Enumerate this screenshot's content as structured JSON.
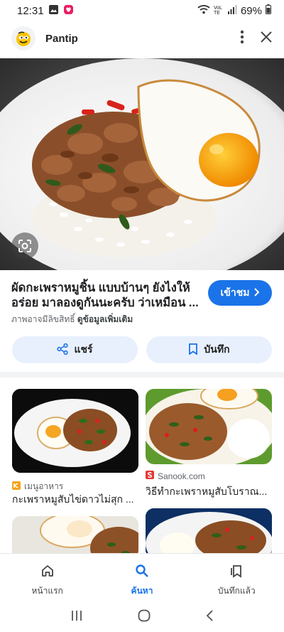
{
  "status": {
    "time": "12:31",
    "battery": "69%",
    "net_label": "VoLTE"
  },
  "header": {
    "site_name": "Pantip"
  },
  "result": {
    "title": "ผัดกะเพราหมูชิ้น แบบบ้านๆ ยังไงให้อร่อย มาลองดูกันนะครับ ว่าเหมือน ...",
    "visit_label": "เข้าชม",
    "copyright_text": "ภาพอาจมีลิขสิทธิ์",
    "more_info": "ดูข้อมูลเพิ่มเติม",
    "share_label": "แชร์",
    "save_label": "บันทึก"
  },
  "related": [
    {
      "source": "เมนูอาหาร",
      "title": "กะเพราหมูสับไข่ดาวไม่สุก ..."
    },
    {
      "source": "Sanook.com",
      "title": "วิธีทำกะเพราหมูสับโบราณ..."
    }
  ],
  "nav": {
    "home": "หน้าแรก",
    "search": "ค้นหา",
    "saved": "บันทึกแล้ว"
  },
  "colors": {
    "accent": "#1a73e8",
    "chip": "#e8f0fe"
  }
}
